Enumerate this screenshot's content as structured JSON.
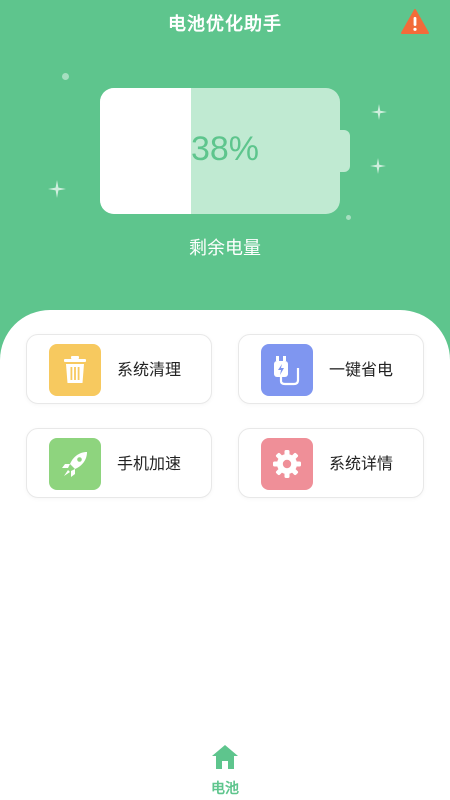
{
  "header": {
    "title": "电池优化助手",
    "background": "#5ec58d"
  },
  "battery": {
    "percent_text": "38%",
    "level": 0.38,
    "label": "剩余电量"
  },
  "actions": [
    {
      "label": "系统清理",
      "icon": "trash-icon",
      "color": "#f7c95f"
    },
    {
      "label": "一键省电",
      "icon": "charger-plug-icon",
      "color": "#7f96f0"
    },
    {
      "label": "手机加速",
      "icon": "rocket-icon",
      "color": "#8ed47e"
    },
    {
      "label": "系统详情",
      "icon": "gear-icon",
      "color": "#ef8f98"
    }
  ],
  "tabbar": {
    "items": [
      {
        "label": "电池",
        "icon": "home-icon",
        "active": true
      }
    ]
  },
  "colors": {
    "accent": "#5ec58d",
    "warning": "#f26b3a"
  }
}
